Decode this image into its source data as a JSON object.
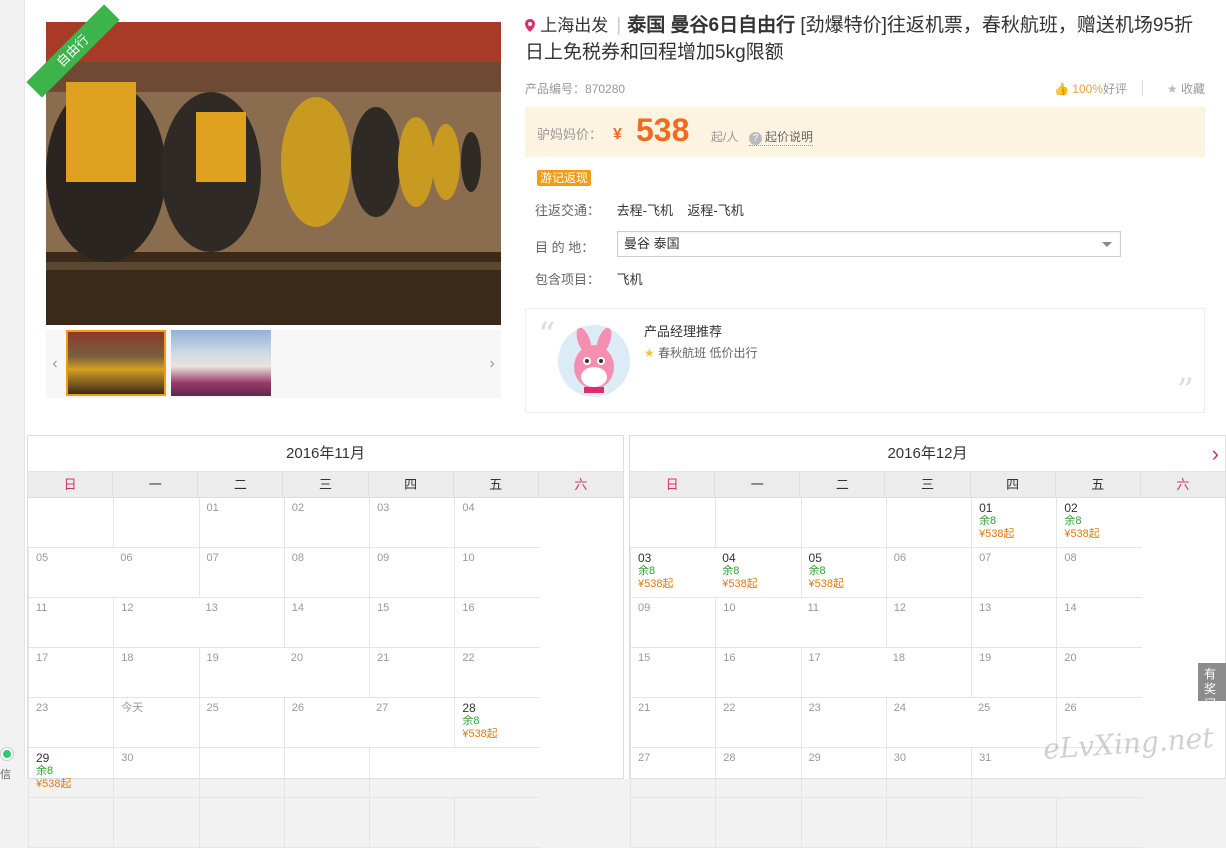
{
  "badge": "自由行",
  "title": {
    "departure": "上海出发",
    "name": "泰国 曼谷6日自由行",
    "desc": "[劲爆特价]往返机票，春秋航班，赠送机场95折日上免税券和回程增加5kg限额"
  },
  "meta": {
    "product_no_label": "产品编号：",
    "product_no": "870280",
    "rating_pct": "100%",
    "rating_label": "好评",
    "favorite_label": "收藏"
  },
  "price": {
    "label": "驴妈妈价：",
    "currency": "¥",
    "value": "538",
    "unit": "起/人",
    "explain": "起价说明"
  },
  "tag": "游记返现",
  "transport": {
    "label": "往返交通：",
    "go": "去程-飞机",
    "back": "返程-飞机"
  },
  "destination": {
    "label": "目 的 地：",
    "value": "曼谷 泰国"
  },
  "includes": {
    "label": "包含项目：",
    "value": "飞机"
  },
  "recommend": {
    "title": "产品经理推荐",
    "text": "春秋航班 低价出行"
  },
  "weekdays": [
    "日",
    "一",
    "二",
    "三",
    "四",
    "五",
    "六"
  ],
  "calendars": [
    {
      "title": "2016年11月",
      "cells": [
        {
          "d": ""
        },
        {
          "d": ""
        },
        {
          "d": "01"
        },
        {
          "d": "02"
        },
        {
          "d": "03"
        },
        {
          "d": "04"
        },
        {
          "d": "05"
        },
        {
          "d": "06"
        },
        {
          "d": "07"
        },
        {
          "d": "08"
        },
        {
          "d": "09"
        },
        {
          "d": "10"
        },
        {
          "d": "11"
        },
        {
          "d": "12"
        },
        {
          "d": "13"
        },
        {
          "d": "14"
        },
        {
          "d": "15"
        },
        {
          "d": "16"
        },
        {
          "d": "17"
        },
        {
          "d": "18"
        },
        {
          "d": "19"
        },
        {
          "d": "20"
        },
        {
          "d": "21"
        },
        {
          "d": "22"
        },
        {
          "d": "23"
        },
        {
          "d": "今天"
        },
        {
          "d": "25"
        },
        {
          "d": "26"
        },
        {
          "d": "27"
        },
        {
          "d": "28",
          "rem": "余8",
          "price": "¥538起"
        },
        {
          "d": "29",
          "rem": "余8",
          "price": "¥538起"
        },
        {
          "d": "30"
        },
        {
          "d": ""
        },
        {
          "d": ""
        },
        {
          "d": ""
        },
        {
          "d": ""
        },
        {
          "d": ""
        },
        {
          "d": ""
        },
        {
          "d": ""
        },
        {
          "d": ""
        },
        {
          "d": ""
        },
        {
          "d": ""
        }
      ]
    },
    {
      "title": "2016年12月",
      "cells": [
        {
          "d": ""
        },
        {
          "d": ""
        },
        {
          "d": ""
        },
        {
          "d": ""
        },
        {
          "d": "01",
          "rem": "余8",
          "price": "¥538起"
        },
        {
          "d": "02",
          "rem": "余8",
          "price": "¥538起"
        },
        {
          "d": "03",
          "rem": "余8",
          "price": "¥538起"
        },
        {
          "d": "04",
          "rem": "余8",
          "price": "¥538起"
        },
        {
          "d": "05",
          "rem": "余8",
          "price": "¥538起"
        },
        {
          "d": "06"
        },
        {
          "d": "07"
        },
        {
          "d": "08"
        },
        {
          "d": "09"
        },
        {
          "d": "10"
        },
        {
          "d": "11"
        },
        {
          "d": "12"
        },
        {
          "d": "13"
        },
        {
          "d": "14"
        },
        {
          "d": "15"
        },
        {
          "d": "16"
        },
        {
          "d": "17"
        },
        {
          "d": "18"
        },
        {
          "d": "19"
        },
        {
          "d": "20"
        },
        {
          "d": "21"
        },
        {
          "d": "22"
        },
        {
          "d": "23"
        },
        {
          "d": "24"
        },
        {
          "d": "25"
        },
        {
          "d": "26"
        },
        {
          "d": "27"
        },
        {
          "d": "28"
        },
        {
          "d": "29"
        },
        {
          "d": "30"
        },
        {
          "d": "31"
        },
        {
          "d": ""
        },
        {
          "d": ""
        },
        {
          "d": ""
        },
        {
          "d": ""
        },
        {
          "d": ""
        },
        {
          "d": ""
        },
        {
          "d": ""
        }
      ]
    }
  ],
  "survey": "有奖问卷",
  "watermark": "eLvXing.net",
  "side_text": "信"
}
